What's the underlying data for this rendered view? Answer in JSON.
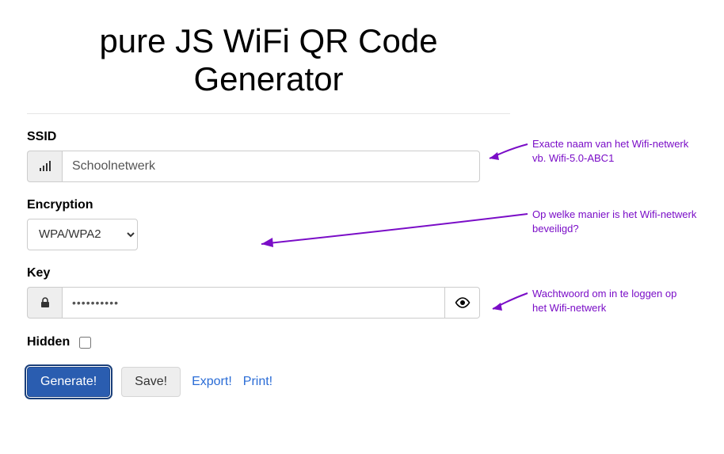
{
  "title": "pure JS WiFi QR Code Generator",
  "fields": {
    "ssid": {
      "label": "SSID",
      "value": "Schoolnetwerk"
    },
    "encryption": {
      "label": "Encryption",
      "selected": "WPA/WPA2"
    },
    "key": {
      "label": "Key",
      "masked": "••••••••••"
    },
    "hidden": {
      "label": "Hidden"
    }
  },
  "buttons": {
    "generate": "Generate!",
    "save": "Save!",
    "export": "Export!",
    "print": "Print!"
  },
  "annotations": {
    "ssid": "Exacte naam van het Wifi-netwerk\nvb. Wifi-5.0-ABC1",
    "encryption": "Op welke manier is het Wifi-netwerk\nbeveiligd?",
    "key": "Wachtwoord om in te loggen op\nhet Wifi-netwerk"
  }
}
